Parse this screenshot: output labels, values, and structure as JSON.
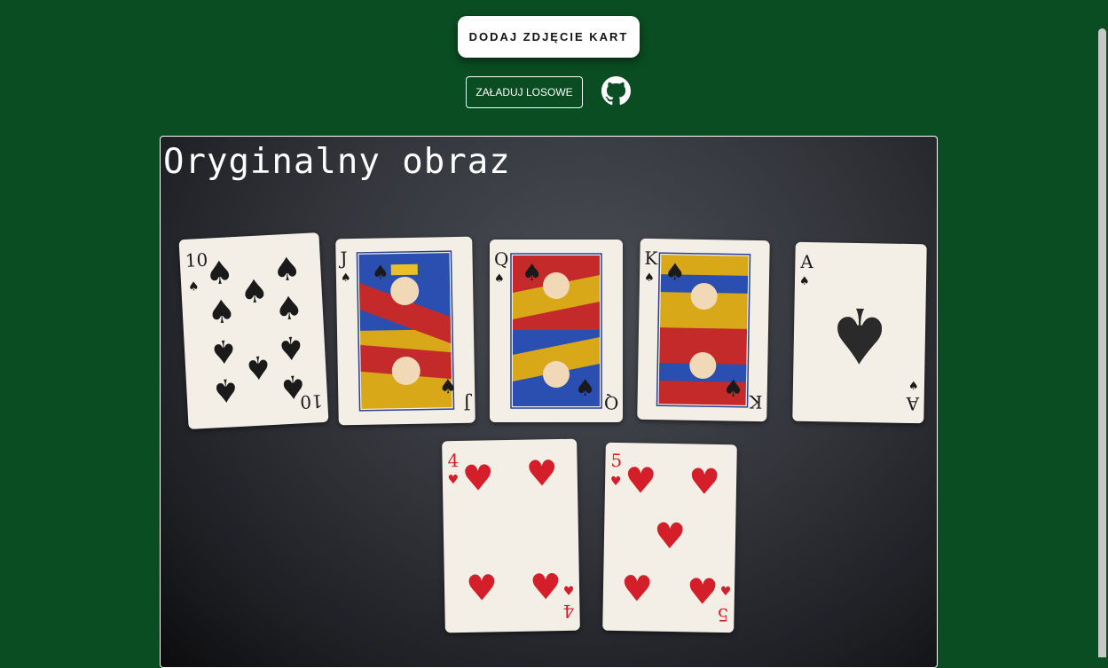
{
  "header": {
    "add_photo_label": "DODAJ ZDJĘCIE KART",
    "load_random_label": "ZAŁADUJ LOSOWE",
    "github_icon": "github-icon"
  },
  "image": {
    "caption": "Oryginalny obraz",
    "cards": [
      {
        "rank": "10",
        "suit": "spades"
      },
      {
        "rank": "J",
        "suit": "spades"
      },
      {
        "rank": "Q",
        "suit": "spades"
      },
      {
        "rank": "K",
        "suit": "spades"
      },
      {
        "rank": "A",
        "suit": "spades"
      },
      {
        "rank": "4",
        "suit": "hearts"
      },
      {
        "rank": "5",
        "suit": "hearts"
      }
    ]
  },
  "colors": {
    "background": "#0a4d22",
    "button_bg": "#ffffff",
    "heart_red": "#d41e2a",
    "spade_black": "#1a1a1a"
  }
}
